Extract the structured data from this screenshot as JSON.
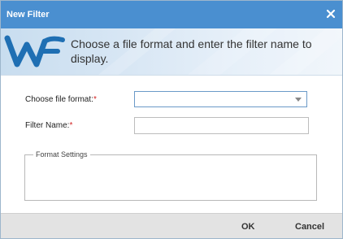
{
  "dialog": {
    "title": "New Filter",
    "close_icon": "close-icon"
  },
  "banner": {
    "logo_icon": "wf-logo-icon",
    "message": "Choose a file format and enter the filter name to display."
  },
  "form": {
    "file_format_label": "Choose file format:",
    "file_format_required": "*",
    "file_format_value": "",
    "filter_name_label": "Filter Name:",
    "filter_name_required": "*",
    "filter_name_value": "",
    "format_settings_legend": "Format Settings"
  },
  "footer": {
    "ok_label": "OK",
    "cancel_label": "Cancel"
  },
  "colors": {
    "titlebar": "#4a8fd0",
    "logo_blue": "#1f6fb3",
    "required": "#d01e1e",
    "footer_bg": "#e3e3e3"
  }
}
